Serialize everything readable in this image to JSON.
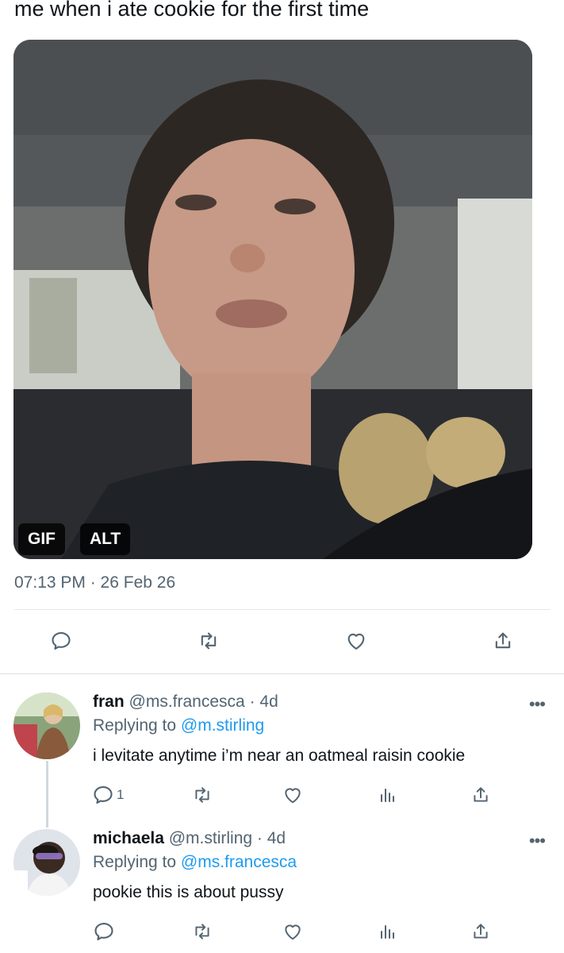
{
  "tweet": {
    "text": "me when i ate cookie for the first time",
    "media_badges": {
      "gif": "GIF",
      "alt": "ALT"
    },
    "timestamp": "07:13 PM · 26 Feb 26"
  },
  "colors": {
    "accent": "#1d9bf0",
    "secondary_text": "#536471",
    "primary_text": "#0f1419"
  },
  "replies": [
    {
      "name": "fran",
      "handle": "@ms.francesca",
      "age": "· 4d",
      "replying_prefix": "Replying to ",
      "replying_to": "@m.stirling",
      "text": "i levitate anytime i’m near an oatmeal raisin cookie",
      "reply_count": "1",
      "more": "•••"
    },
    {
      "name": "michaela",
      "handle": "@m.stirling",
      "age": "· 4d",
      "replying_prefix": "Replying to ",
      "replying_to": "@ms.francesca",
      "text": "pookie this is about pussy",
      "reply_count": "",
      "more": "•••"
    }
  ]
}
